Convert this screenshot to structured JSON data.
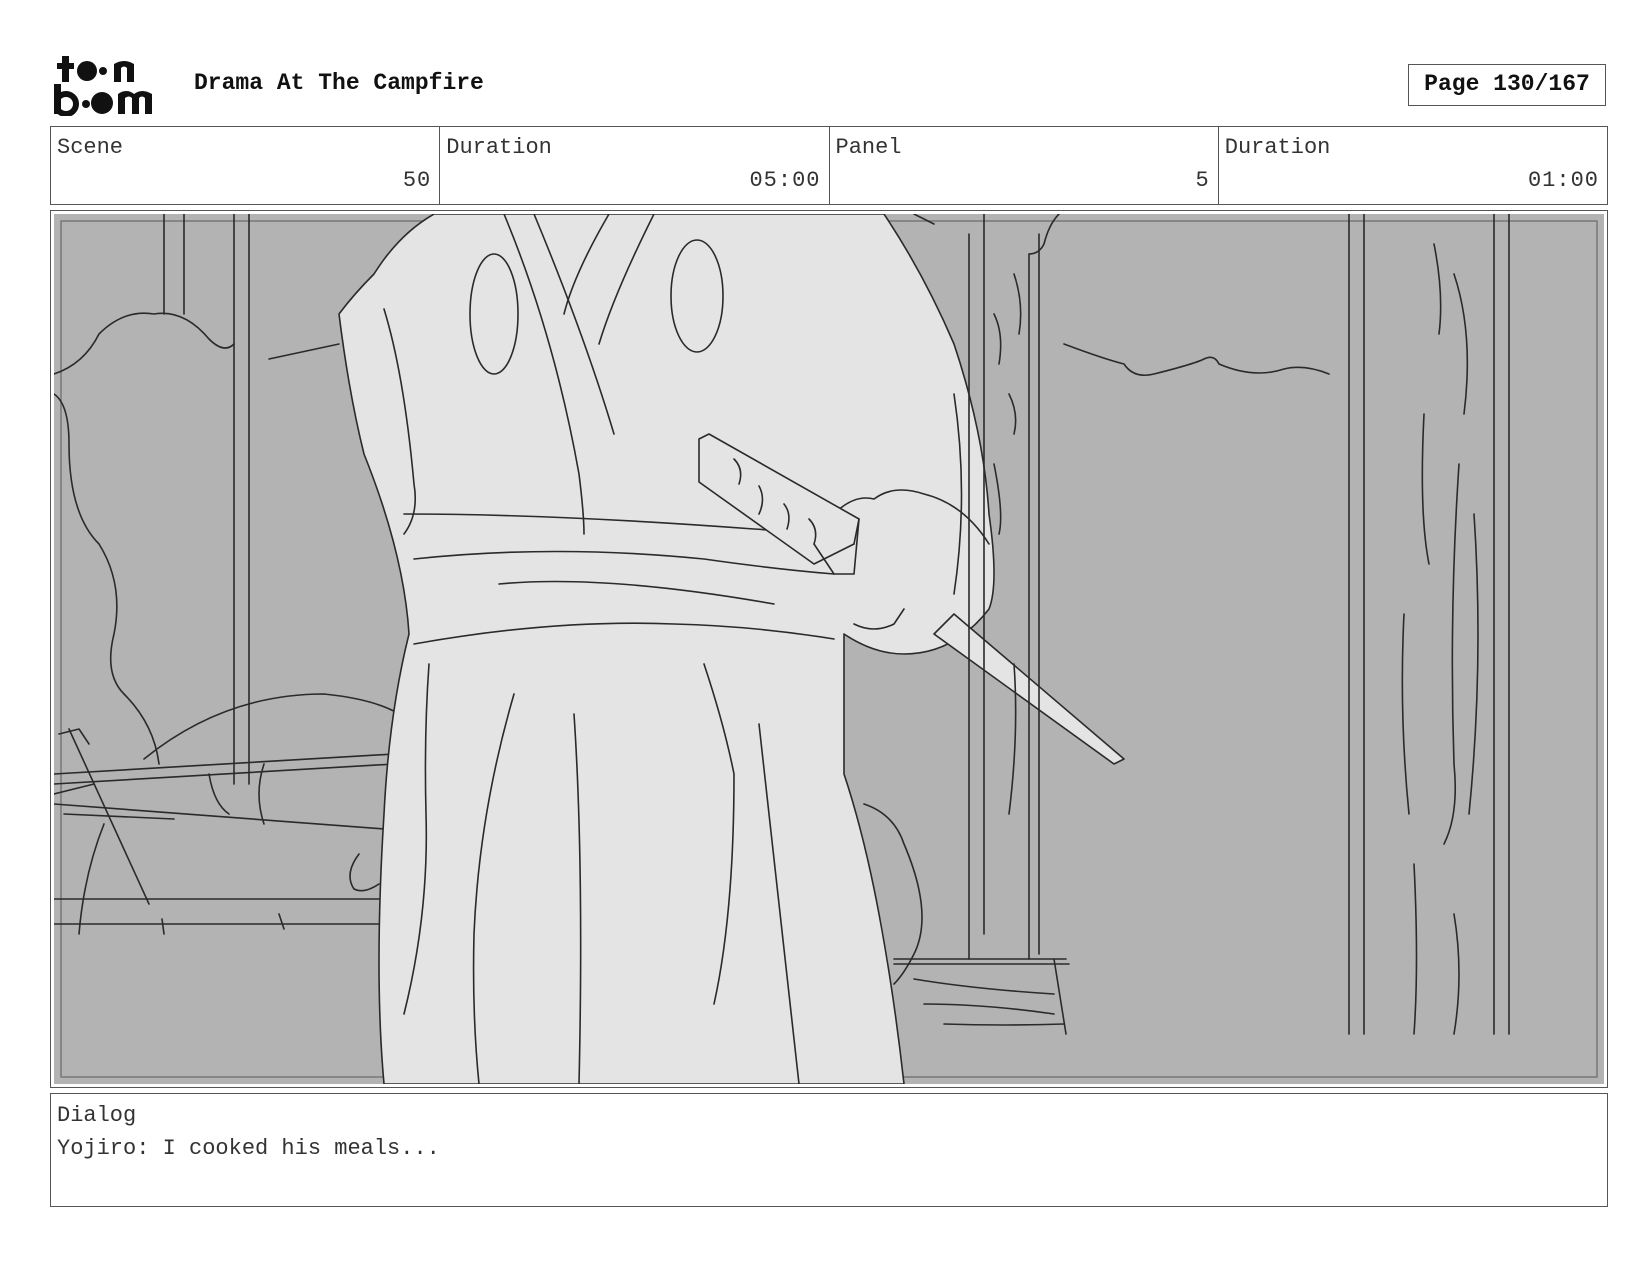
{
  "header": {
    "logo_text": "toonboom",
    "project_title": "Drama At The Campfire",
    "page_label": "Page 130/167"
  },
  "info": {
    "scene_label": "Scene",
    "scene_value": "50",
    "scene_duration_label": "Duration",
    "scene_duration_value": "05:00",
    "panel_label": "Panel",
    "panel_value": "5",
    "panel_duration_label": "Duration",
    "panel_duration_value": "01:00"
  },
  "dialog": {
    "label": "Dialog",
    "text": "Yojiro: I cooked his meals..."
  },
  "colors": {
    "background_fill": "#b3b3b3",
    "figure_fill": "#e4e4e4",
    "line": "#2a2a2a"
  }
}
